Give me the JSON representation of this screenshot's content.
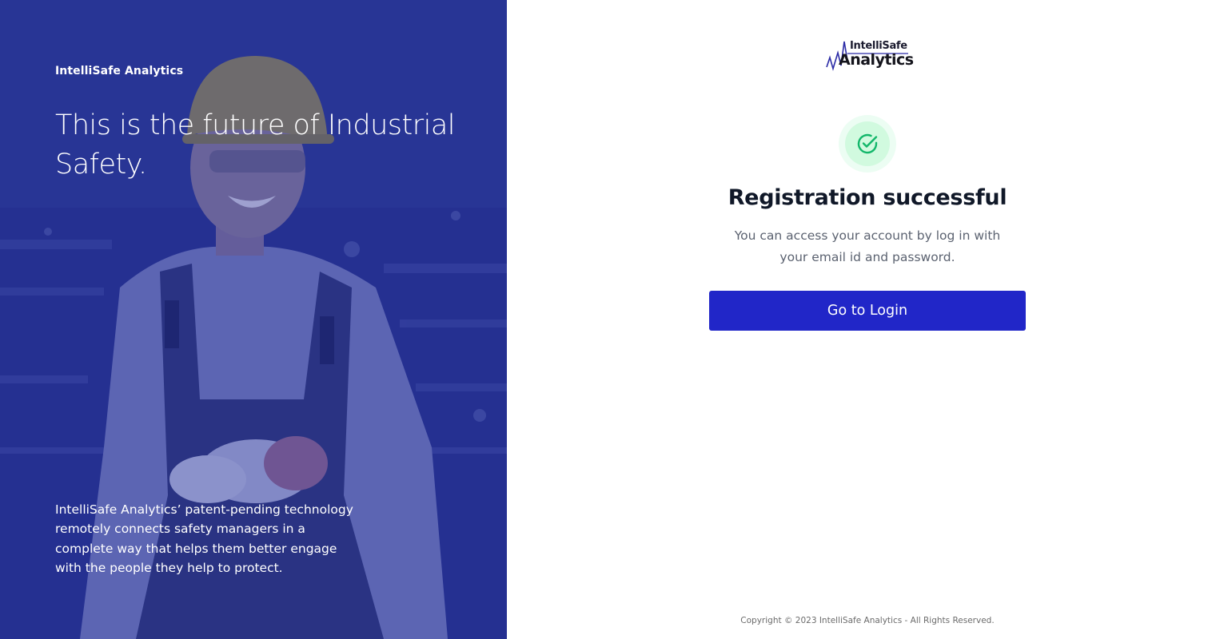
{
  "hero": {
    "brand": "IntelliSafe Analytics",
    "headline": "This is the future of Industrial Safety.",
    "description": "IntelliSafe Analytics’ patent-pending technology remotely connects safety managers in a complete way that helps them better engage with the people they help to protect."
  },
  "logo": {
    "line1": "IntelliSafe",
    "line2": "Analytics"
  },
  "confirmation": {
    "icon": "check-circle-icon",
    "title": "Registration successful",
    "message": "You can access your account by log in with your email id and password."
  },
  "actions": {
    "login_label": "Go to Login"
  },
  "footer": {
    "copyright": "Copyright © 2023 IntelliSafe Analytics - All Rights Reserved."
  },
  "colors": {
    "primary": "#2126c8",
    "hero_overlay": "#23308f",
    "success": "#12b76a",
    "success_bg": "#d1fadf"
  }
}
